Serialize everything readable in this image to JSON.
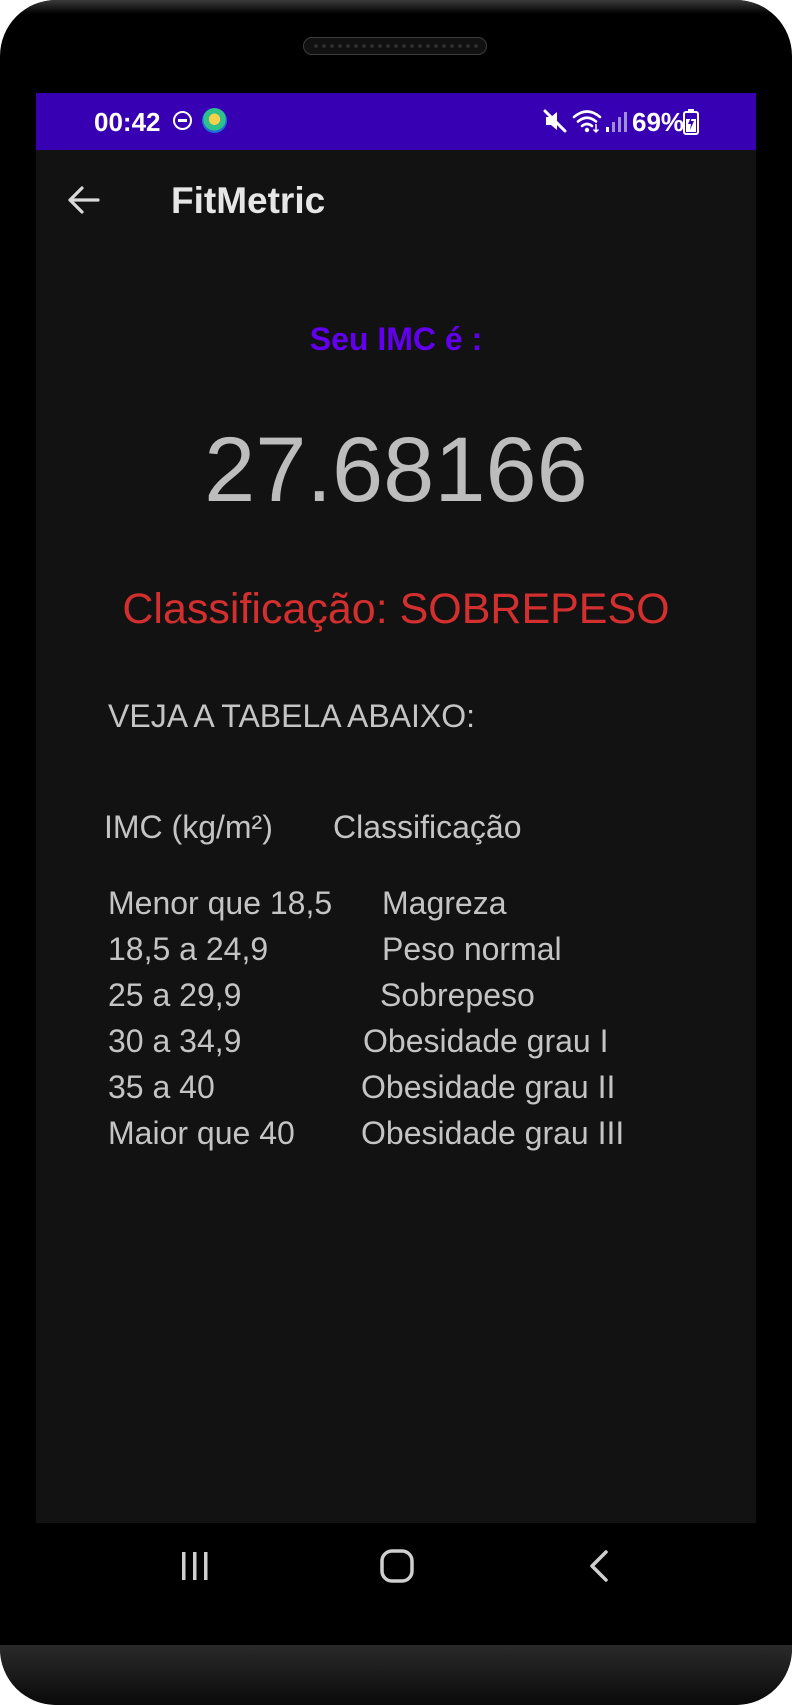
{
  "status_bar": {
    "time": "00:42",
    "battery_percent": "69%",
    "icons": [
      "do-not-disturb-icon",
      "app-notification-icon",
      "mute-icon",
      "wifi-icon",
      "signal-icon",
      "battery-charging-icon"
    ],
    "background_color": "#3700b3"
  },
  "app_bar": {
    "title": "FitMetric",
    "back_icon": "arrow-left-icon"
  },
  "result": {
    "label": "Seu IMC é :",
    "value": "27.68166",
    "classification": "Classificação: SOBREPESO",
    "label_color": "#6200ee",
    "classification_color": "#d32f2f"
  },
  "table": {
    "heading": "VEJA A TABELA ABAIXO:",
    "headers": {
      "imc": "IMC (kg/m²)",
      "classification": "Classificação"
    },
    "rows": [
      {
        "range": "Menor que 18,5",
        "classification": "Magreza"
      },
      {
        "range": "18,5 a 24,9",
        "classification": "Peso normal"
      },
      {
        "range": "25 a 29,9",
        "classification": "Sobrepeso"
      },
      {
        "range": "30 a 34,9",
        "classification": "Obesidade grau I"
      },
      {
        "range": "35 a 40",
        "classification": "Obesidade grau II"
      },
      {
        "range": "Maior que 40",
        "classification": "Obesidade grau III"
      }
    ]
  },
  "nav_bar": {
    "icons": [
      "recent-apps-icon",
      "home-icon",
      "back-icon"
    ]
  }
}
